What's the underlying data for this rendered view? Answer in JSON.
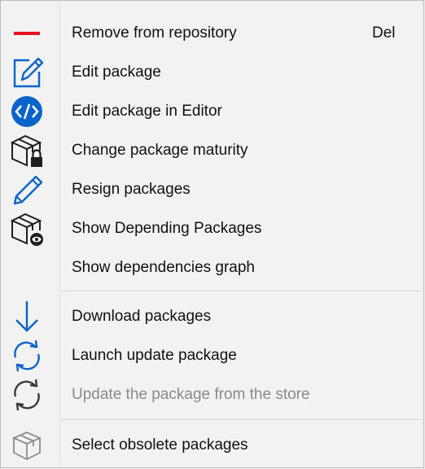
{
  "menu": {
    "items": [
      {
        "label": "Remove from repository",
        "shortcut": "Del",
        "icon": "minus-icon",
        "enabled": true
      },
      {
        "label": "Edit package",
        "icon": "edit-square-icon",
        "enabled": true
      },
      {
        "label": "Edit package in Editor",
        "icon": "code-icon",
        "enabled": true
      },
      {
        "label": "Change package maturity",
        "icon": "package-lock-icon",
        "enabled": true
      },
      {
        "label": "Resign packages",
        "icon": "pencil-icon",
        "enabled": true
      },
      {
        "label": "Show Depending Packages",
        "icon": "package-eye-icon",
        "enabled": true
      },
      {
        "label": "Show dependencies graph",
        "icon": "",
        "enabled": true
      },
      {
        "label": "Download packages",
        "icon": "download-arrow-icon",
        "enabled": true
      },
      {
        "label": "Launch update package",
        "icon": "refresh-blue-icon",
        "enabled": true
      },
      {
        "label": "Update the package from the store",
        "icon": "refresh-gray-icon",
        "enabled": false
      },
      {
        "label": "Select obsolete packages",
        "icon": "package-outline-icon",
        "enabled": true
      }
    ]
  },
  "colors": {
    "red": "#e81123",
    "blue": "#0a63c9",
    "dark": "#1e1e1e",
    "gray": "#8c8c8c"
  }
}
